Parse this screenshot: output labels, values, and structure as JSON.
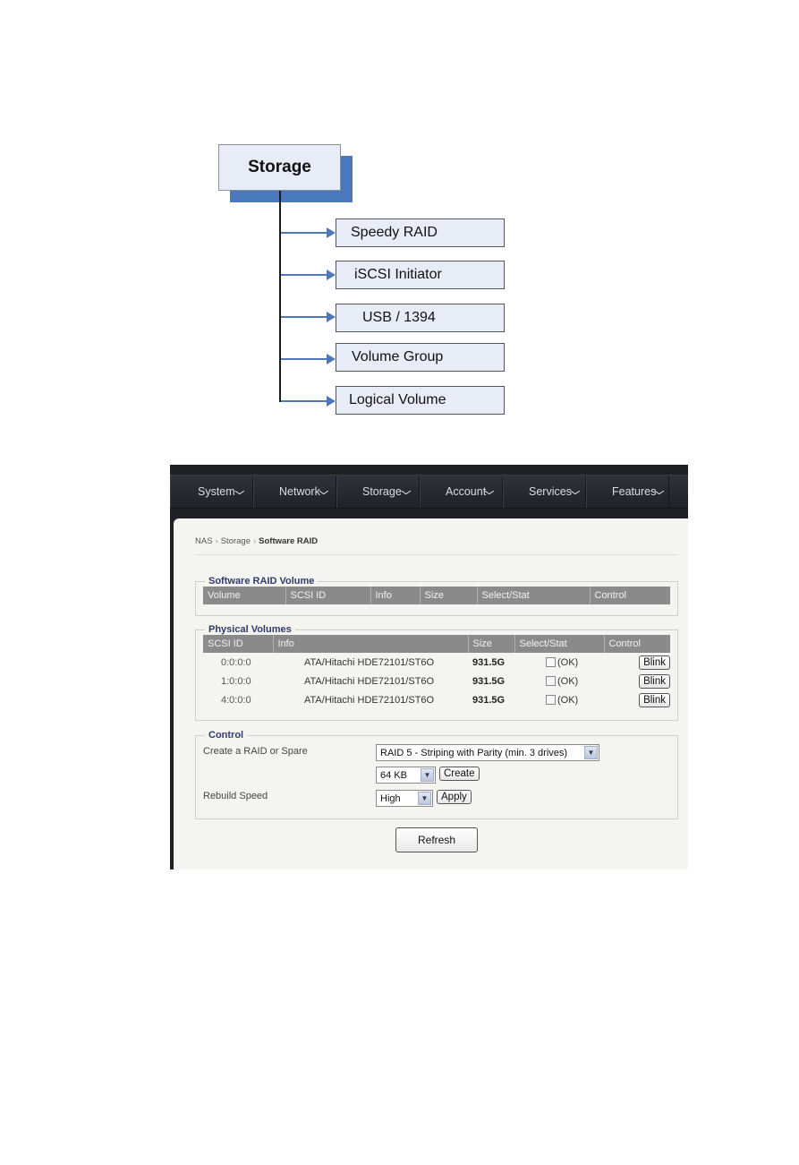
{
  "diagram": {
    "root": "Storage",
    "children": [
      "Speedy RAID",
      "iSCSI Initiator",
      "USB / 1394",
      "Volume Group",
      "Logical Volume"
    ],
    "colors": {
      "accent": "#4a78bd",
      "box_fill": "#e8ecf6"
    }
  },
  "nav": {
    "items": [
      {
        "label": "System"
      },
      {
        "label": "Network"
      },
      {
        "label": "Storage"
      },
      {
        "label": "Account"
      },
      {
        "label": "Services"
      },
      {
        "label": "Features"
      }
    ],
    "chevron_icon": "chevron-down-icon",
    "chevron_glyph": "⌄"
  },
  "breadcrumb": {
    "items": [
      "NAS",
      "Storage",
      "Software RAID"
    ],
    "separator": "›"
  },
  "software_raid": {
    "title": "Software RAID Volume",
    "columns": [
      "Volume",
      "SCSI ID",
      "Info",
      "Size",
      "Select/Stat",
      "Control"
    ]
  },
  "physical": {
    "title": "Physical Volumes",
    "columns": [
      "SCSI ID",
      "Info",
      "Size",
      "Select/Stat",
      "Control"
    ],
    "rows": [
      {
        "scsi_id": "0:0:0:0",
        "info": "ATA/Hitachi HDE72101/ST6O",
        "size": "931.5G",
        "status": "(OK)",
        "checked": false,
        "control": "Blink"
      },
      {
        "scsi_id": "1:0:0:0",
        "info": "ATA/Hitachi HDE72101/ST6O",
        "size": "931.5G",
        "status": "(OK)",
        "checked": false,
        "control": "Blink"
      },
      {
        "scsi_id": "4:0:0:0",
        "info": "ATA/Hitachi HDE72101/ST6O",
        "size": "931.5G",
        "status": "(OK)",
        "checked": false,
        "control": "Blink"
      }
    ]
  },
  "control": {
    "title": "Control",
    "create_label": "Create a RAID or Spare",
    "raid_type": "RAID 5 - Striping with Parity (min. 3 drives)",
    "stripe_size": "64 KB",
    "create_button": "Create",
    "rebuild_label": "Rebuild Speed",
    "rebuild_speed": "High",
    "apply_button": "Apply"
  },
  "refresh_button": "Refresh"
}
